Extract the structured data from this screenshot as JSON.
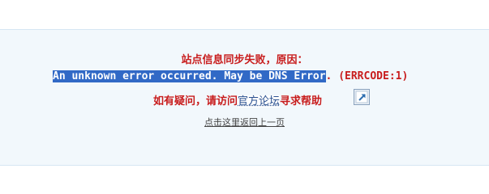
{
  "error": {
    "title": "站点信息同步失败，原因：",
    "message_selected": "An unknown error occurred. May be DNS Error",
    "message_rest": ". (ERRCODE:1)",
    "help_prefix": "如有疑问，请访问",
    "help_link": "官方论坛",
    "help_suffix": "寻求帮助",
    "back_link": "点击这里返回上一页"
  },
  "icons": {
    "external": "external-link-icon"
  },
  "colors": {
    "panel_bg": "#f2f8fc",
    "accent_red": "#c81d1d",
    "selection_blue": "#3169c6",
    "link_blue": "#2a5190"
  }
}
